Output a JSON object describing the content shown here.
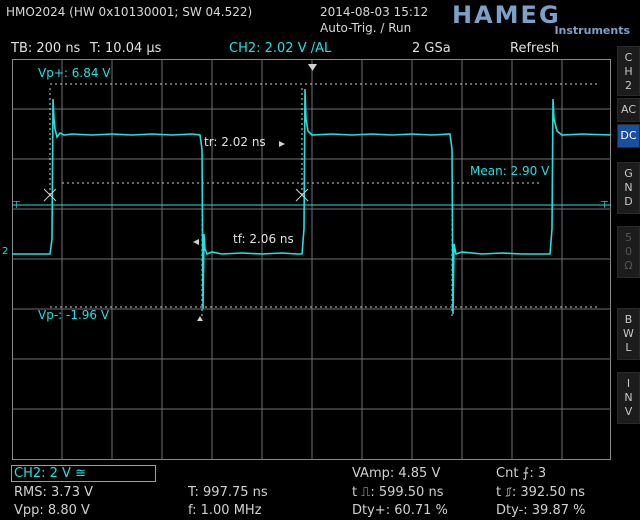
{
  "header": {
    "device": "HMO2024 (HW 0x10130001; SW 04.522)",
    "datetime": "2014-08-03 15:12",
    "trigger_status": "Auto-Trig. / Run",
    "logo": "HAMEG",
    "logo_sub": "Instruments"
  },
  "info_bar": {
    "timebase": "TB: 200 ns",
    "trigger_time": "T: 10.04 µs",
    "trigger_channel": "CH2: 2.02 V",
    "trigger_slope": "/",
    "trigger_coupling": "AL",
    "sample_rate": "2 GSa",
    "mode": "Refresh"
  },
  "overlays": {
    "vp_plus": "Vp+: 6.84 V",
    "vp_minus": "Vp-: -1.96 V",
    "tr": "tr: 2.02 ns",
    "tf": "tf: 2.06 ns",
    "mean": "Mean: 2.90 V",
    "ch_marker": "2"
  },
  "right_panel": {
    "channel": [
      "C",
      "H",
      "2"
    ],
    "ac": "AC",
    "dc": "DC",
    "gnd": [
      "G",
      "N",
      "D"
    ],
    "fifty": [
      "5",
      "0",
      "Ω"
    ],
    "bwl": [
      "B",
      "W",
      "L"
    ],
    "inv": [
      "I",
      "N",
      "V"
    ]
  },
  "measurements": {
    "ch2_scale": "CH2: 2 V",
    "ch2_coupling": "≅",
    "rms": "RMS: 3.73 V",
    "vpp": "Vpp: 8.80 V",
    "period": "T: 997.75 ns",
    "freq": "f: 1.00 MHz",
    "vamp": "VAmp: 4.85 V",
    "t_pos_pulse": "t ⎍: 599.50 ns",
    "dty_plus": "Dty+: 60.71 %",
    "cnt": "Cnt ⨍: 3",
    "t_neg_pulse": "t ⎎: 392.50 ns",
    "dty_minus": "Dty-: 39.87 %"
  },
  "colors": {
    "trace": "#22e0e0",
    "grid": "#6a6a6a",
    "accent": "#1a4fa0",
    "logo": "#7da0c8"
  }
}
